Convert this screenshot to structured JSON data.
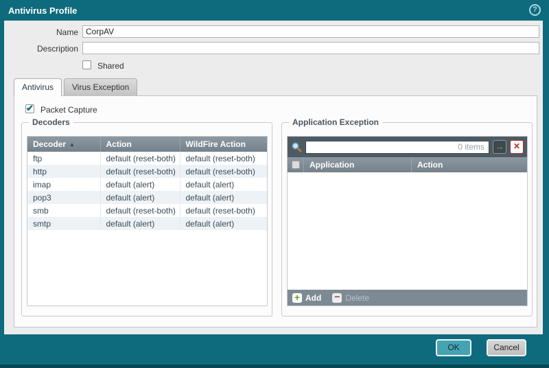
{
  "dialog": {
    "title": "Antivirus Profile",
    "help_glyph": "?"
  },
  "form": {
    "name_label": "Name",
    "name_value": "CorpAV",
    "description_label": "Description",
    "description_value": "",
    "shared_label": "Shared",
    "shared_checked": false
  },
  "tabs": [
    {
      "label": "Antivirus",
      "active": true
    },
    {
      "label": "Virus Exception",
      "active": false
    }
  ],
  "antivirus_tab": {
    "packet_capture_label": "Packet Capture",
    "packet_capture_checked": true,
    "decoders": {
      "legend": "Decoders",
      "columns": [
        "Decoder",
        "Action",
        "WildFire Action"
      ],
      "sort_column": "Decoder",
      "sort_direction": "asc",
      "rows": [
        {
          "decoder": "ftp",
          "action": "default (reset-both)",
          "wildfire_action": "default (reset-both)"
        },
        {
          "decoder": "http",
          "action": "default (reset-both)",
          "wildfire_action": "default (reset-both)"
        },
        {
          "decoder": "imap",
          "action": "default (alert)",
          "wildfire_action": "default (alert)"
        },
        {
          "decoder": "pop3",
          "action": "default (alert)",
          "wildfire_action": "default (alert)"
        },
        {
          "decoder": "smb",
          "action": "default (reset-both)",
          "wildfire_action": "default (reset-both)"
        },
        {
          "decoder": "smtp",
          "action": "default (alert)",
          "wildfire_action": "default (alert)"
        }
      ]
    },
    "application_exception": {
      "legend": "Application Exception",
      "search_value": "",
      "items_count": "0 items",
      "go_glyph": "→",
      "clear_glyph": "✕",
      "columns": [
        "Application",
        "Action"
      ],
      "rows": [],
      "add_label": "Add",
      "add_glyph": "+",
      "delete_label": "Delete",
      "delete_glyph": "−",
      "delete_enabled": false
    }
  },
  "footer": {
    "ok_label": "OK",
    "cancel_label": "Cancel"
  },
  "colors": {
    "frame_teal": "#0e6a7d",
    "bottom_edge_teal": "#0a4754",
    "body_gray": "#ececec",
    "panel_white": "#fcfcfc",
    "table_header_gray": "#75818a",
    "search_toolbar_dark": "#4e5b63",
    "footer_toolbar_gray": "#7e8a93",
    "alt_row_blue": "#edf2f6",
    "ok_button_teal": "#45a3b3",
    "add_green": "#6e9c1f",
    "delete_red": "#a23327",
    "check_teal": "#0c6d84"
  }
}
